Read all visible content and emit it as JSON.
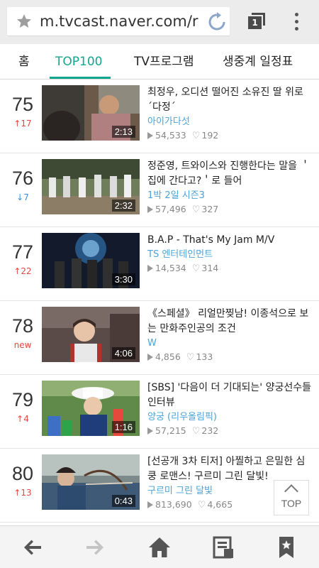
{
  "browser": {
    "url": "m.tvcast.naver.com/r",
    "tab_count": "1"
  },
  "nav": {
    "tabs": [
      {
        "label": "홈"
      },
      {
        "label": "TOP100"
      },
      {
        "label": "TV프로그램"
      },
      {
        "label": "생중계 일정표"
      }
    ],
    "active": "TOP100"
  },
  "items": [
    {
      "rank": "75",
      "change": "↑17",
      "change_type": "up",
      "duration": "2:13",
      "title": "최정우, 오디션 떨어진 소유진 딸 위로 ´다정´",
      "channel": "아이가다섯",
      "views": "54,533",
      "likes": "192"
    },
    {
      "rank": "76",
      "change": "↓7",
      "change_type": "down",
      "duration": "2:32",
      "title": "정준영, 트와이스와 진행한다는 말을 ＇집에 간다고?＇로 들어",
      "channel": "1박 2일 시즌3",
      "views": "57,496",
      "likes": "327"
    },
    {
      "rank": "77",
      "change": "↑22",
      "change_type": "up",
      "duration": "3:30",
      "title": "B.A.P - That's My Jam M/V",
      "channel": "TS 엔터테인먼트",
      "views": "14,534",
      "likes": "314"
    },
    {
      "rank": "78",
      "change": "new",
      "change_type": "new",
      "duration": "4:06",
      "title": "《스페셜》 리얼만찢남! 이종석으로 보는 만화주인공의 조건",
      "channel": "W",
      "views": "4,856",
      "likes": "133"
    },
    {
      "rank": "79",
      "change": "↑4",
      "change_type": "up",
      "duration": "1:16",
      "title": "[SBS] '다음이 더 기대되는' 양궁선수들 인터뷰",
      "channel": "양궁 (리우올림픽)",
      "views": "57,215",
      "likes": "232"
    },
    {
      "rank": "80",
      "change": "↑13",
      "change_type": "up",
      "duration": "0:43",
      "title": "[선공개 3차 티저] 아찔하고 은밀한 심쿵 로맨스! 구르미 그린 달빛!",
      "channel": "구르미 그린 달빛",
      "views": "813,690",
      "likes": "4,665"
    }
  ],
  "top_button": {
    "label": "TOP"
  },
  "toolbar": {
    "icons": [
      "back-arrow-icon",
      "forward-arrow-icon",
      "home-icon",
      "reader-icon",
      "bookmark-icon"
    ]
  }
}
